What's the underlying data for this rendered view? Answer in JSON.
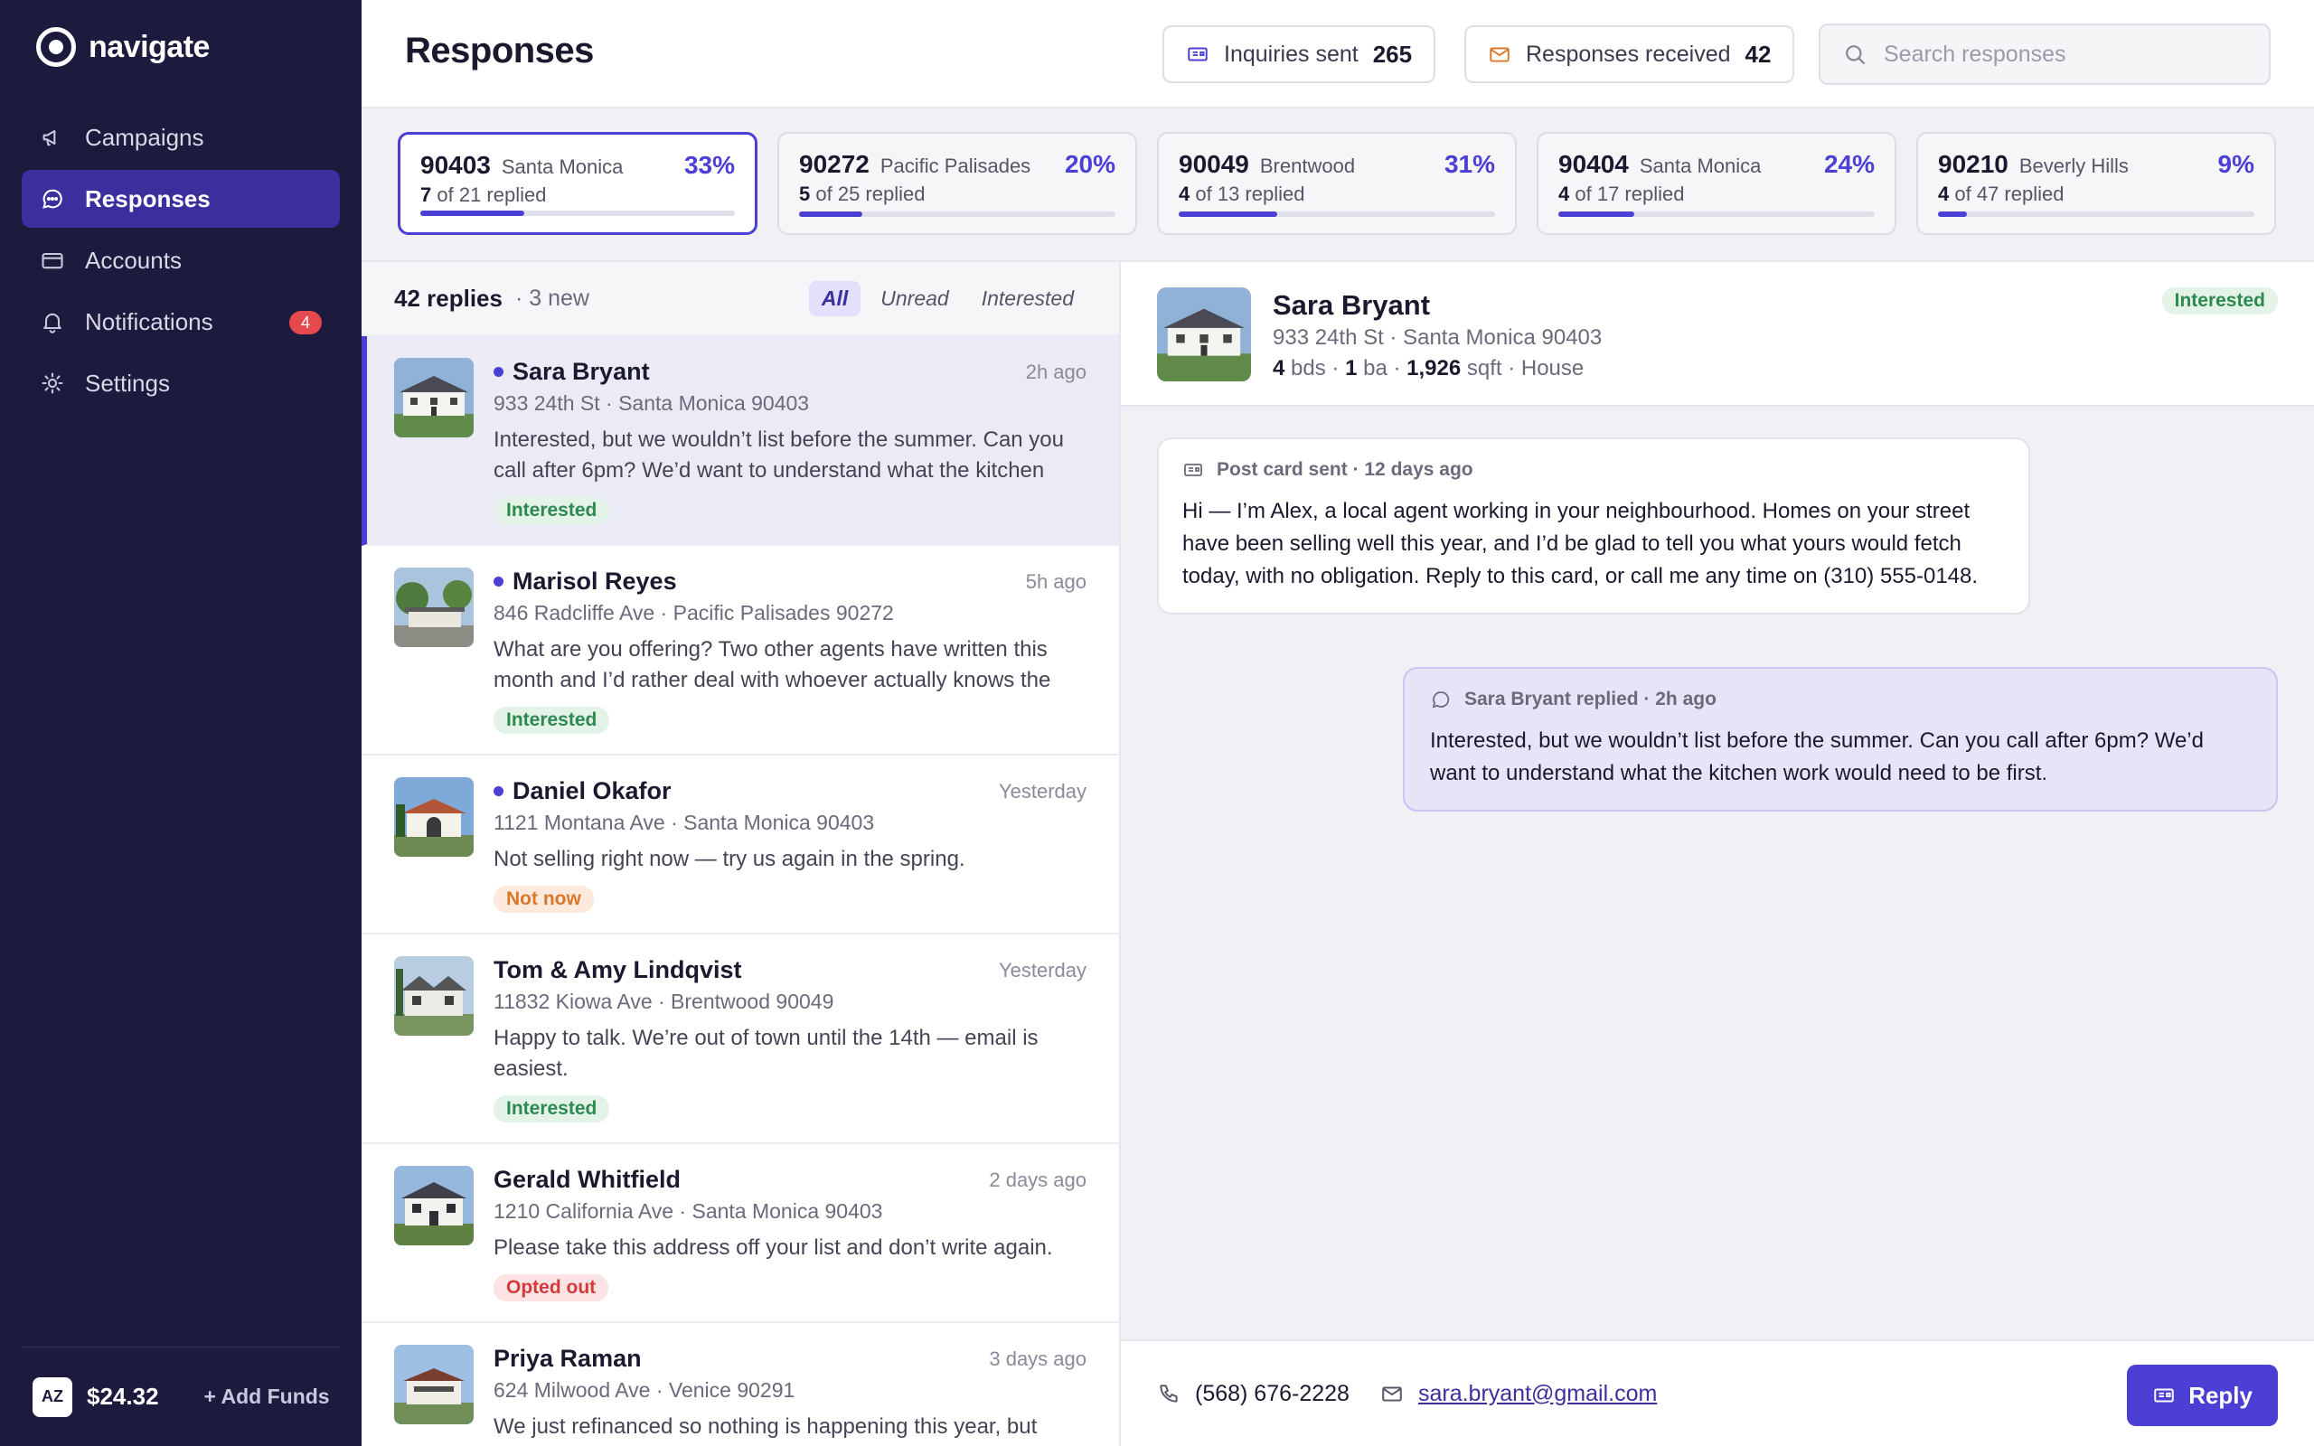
{
  "app": {
    "name": "navigate",
    "accent": "#4b3fd4",
    "sidebar_bg": "#1c1a3d"
  },
  "sidebar": {
    "items": [
      {
        "label": "Campaigns",
        "icon": "megaphone-icon"
      },
      {
        "label": "Responses",
        "icon": "chat-bubble-icon",
        "active": true
      },
      {
        "label": "Accounts",
        "icon": "card-icon"
      },
      {
        "label": "Notifications",
        "icon": "bell-icon",
        "badge": "4"
      },
      {
        "label": "Settings",
        "icon": "gear-icon"
      }
    ],
    "footer": {
      "avatar_initials": "AZ",
      "balance": "$24.32",
      "add_funds": "+ Add Funds"
    }
  },
  "header": {
    "title": "Responses",
    "inquiries": {
      "label": "Inquiries sent",
      "value": "265"
    },
    "responses": {
      "label": "Responses received",
      "value": "42"
    },
    "search_placeholder": "Search responses"
  },
  "zips": [
    {
      "code": "90403",
      "city": "Santa Monica",
      "pct": "33%",
      "replied": "7",
      "of_text": "of 21 replied",
      "rate": 0.33,
      "active": true
    },
    {
      "code": "90272",
      "city": "Pacific Palisades",
      "pct": "20%",
      "replied": "5",
      "of_text": "of 25 replied",
      "rate": 0.2
    },
    {
      "code": "90049",
      "city": "Brentwood",
      "pct": "31%",
      "replied": "4",
      "of_text": "of 13 replied",
      "rate": 0.31
    },
    {
      "code": "90404",
      "city": "Santa Monica",
      "pct": "24%",
      "replied": "4",
      "of_text": "of 17 replied",
      "rate": 0.24
    },
    {
      "code": "90210",
      "city": "Beverly Hills",
      "pct": "9%",
      "replied": "4",
      "of_text": "of 47 replied",
      "rate": 0.09
    }
  ],
  "list": {
    "count": "42 replies",
    "new_text": "· 3 new",
    "filters": [
      "All",
      "Unread",
      "Interested"
    ],
    "rows": [
      {
        "name": "Sara Bryant",
        "time": "2h ago",
        "address": "933 24th St · Santa Monica 90403",
        "message": "Interested, but we wouldn’t list before the summer. Can you call after 6pm? We’d want to understand what the kitchen work would need to be first.",
        "tag": "Interested",
        "unread": true,
        "selected": true
      },
      {
        "name": "Marisol Reyes",
        "time": "5h ago",
        "address": "846 Radcliffe Ave · Pacific Palisades 90272",
        "message": "What are you offering? Two other agents have written this month and I’d rather deal with whoever actually knows the area.",
        "tag": "Interested",
        "unread": true
      },
      {
        "name": "Daniel Okafor",
        "time": "Yesterday",
        "address": "1121 Montana Ave · Santa Monica 90403",
        "message": "Not selling right now — try us again in the spring.",
        "tag": "Not now",
        "unread": true
      },
      {
        "name": "Tom & Amy Lindqvist",
        "time": "Yesterday",
        "address": "11832 Kiowa Ave · Brentwood 90049",
        "message": "Happy to talk. We’re out of town until the 14th — email is easiest.",
        "tag": "Interested"
      },
      {
        "name": "Gerald Whitfield",
        "time": "2 days ago",
        "address": "1210 California Ave · Santa Monica 90403",
        "message": "Please take this address off your list and don’t write again.",
        "tag": "Opted out"
      },
      {
        "name": "Priya Raman",
        "time": "3 days ago",
        "address": "624 Milwood Ave · Venice 90291",
        "message": "We just refinanced so nothing is happening this year, but",
        "tag": ""
      }
    ]
  },
  "detail": {
    "name": "Sara Bryant",
    "address": "933 24th St · Santa Monica 90403",
    "facts": {
      "beds": "4",
      "beds_unit": "bds",
      "baths": "1",
      "baths_unit": "ba",
      "sqft": "1,926",
      "sqft_unit": "sqft",
      "type": "House"
    },
    "tag": "Interested",
    "sent": {
      "meta": "Post card sent · 12 days ago",
      "text": "Hi — I’m Alex, a local agent working in your neighbourhood. Homes on your street have been selling well this year, and I’d be glad to tell you what yours would fetch today, with no obligation. Reply to this card, or call me any time on (310) 555-0148."
    },
    "reply": {
      "meta": "Sara Bryant replied · 2h ago",
      "text": "Interested, but we wouldn’t list before the summer. Can you call after 6pm? We’d want to understand what the kitchen work would need to be first."
    },
    "phone": "(568) 676-2228",
    "email": "sara.bryant@gmail.com",
    "reply_button": "Reply"
  }
}
